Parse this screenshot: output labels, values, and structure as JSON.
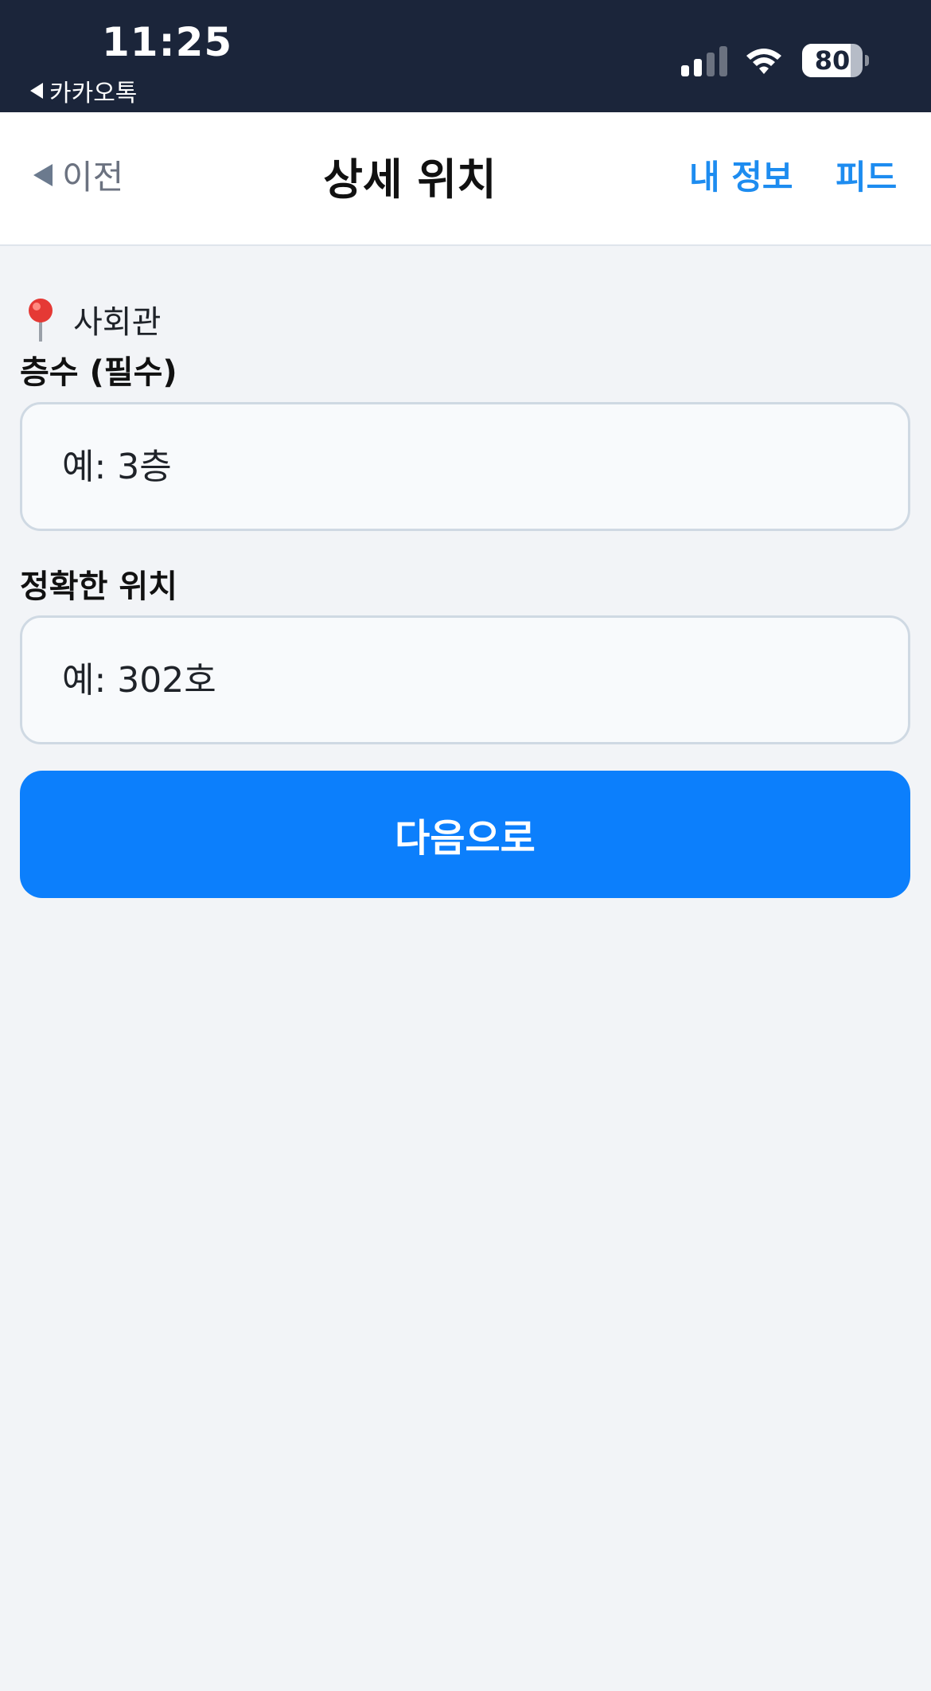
{
  "status_bar": {
    "time": "11:25",
    "back_app": "카카오톡",
    "battery_level": 80,
    "battery_text": "80"
  },
  "nav": {
    "back_label": "이전",
    "title": "상세 위치",
    "my_info_label": "내 정보",
    "feed_label": "피드"
  },
  "location": {
    "name": "사회관",
    "icon": "pushpin-icon"
  },
  "form": {
    "floor_label": "층수 (필수)",
    "floor_placeholder": "예: 3층",
    "floor_value": "",
    "exact_label": "정확한 위치",
    "exact_placeholder": "예: 302호",
    "exact_value": "",
    "next_label": "다음으로"
  },
  "colors": {
    "status_bar_bg": "#1b253a",
    "accent": "#0c7ffc",
    "link": "#1d8cf0",
    "background": "#f2f4f7"
  }
}
